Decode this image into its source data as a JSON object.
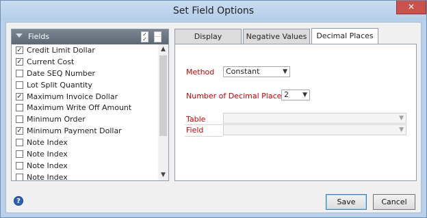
{
  "window": {
    "title": "Set Field Options",
    "close_glyph": "✕"
  },
  "fields": {
    "header_label": "Fields",
    "items": [
      {
        "label": "Credit Limit Dollar",
        "checked": true
      },
      {
        "label": "Current Cost",
        "checked": true
      },
      {
        "label": "Date SEQ Number",
        "checked": false
      },
      {
        "label": "Lot Split Quantity",
        "checked": false
      },
      {
        "label": "Maximum Invoice Dollar",
        "checked": true
      },
      {
        "label": "Maximum Write Off Amount",
        "checked": false
      },
      {
        "label": "Minimum Order",
        "checked": false
      },
      {
        "label": "Minimum Payment Dollar",
        "checked": true
      },
      {
        "label": "Note Index",
        "checked": false
      },
      {
        "label": "Note Index",
        "checked": false
      },
      {
        "label": "Note Index",
        "checked": false
      },
      {
        "label": "Note Index",
        "checked": false
      }
    ]
  },
  "tabs": [
    {
      "label": "Display",
      "active": false
    },
    {
      "label": "Negative Values",
      "active": false
    },
    {
      "label": "Decimal Places",
      "active": true
    }
  ],
  "decimal_places": {
    "method_label": "Method",
    "method_value": "Constant",
    "num_label": "Number of Decimal Places",
    "num_value": "2",
    "table_label": "Table",
    "table_value": "",
    "field_label": "Field",
    "field_value": ""
  },
  "buttons": {
    "save": "Save",
    "cancel": "Cancel"
  },
  "colors": {
    "required_label": "#cc0000",
    "title_bar": "#b9d1ea"
  }
}
